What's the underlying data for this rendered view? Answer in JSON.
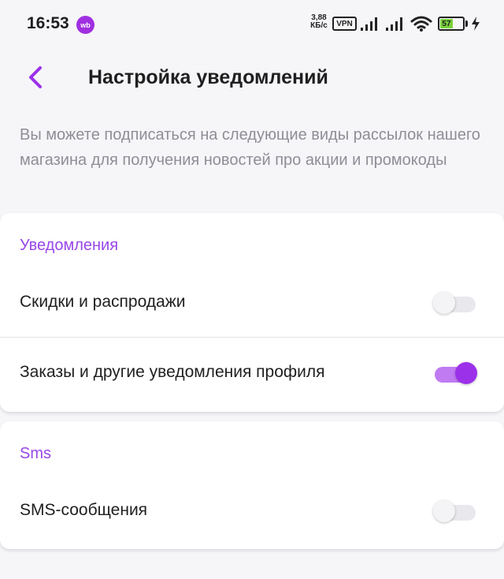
{
  "status_bar": {
    "time": "16:53",
    "app_badge": "wb",
    "net_speed_value": "3,88",
    "net_speed_unit": "КБ/с",
    "vpn": "VPN",
    "battery": "57"
  },
  "header": {
    "title": "Настройка уведомлений",
    "back_icon": "chevron-left-icon"
  },
  "description": "Вы можете подписаться на следующие виды рассылок нашего магазина для получения новостей про акции и промокоды",
  "sections": [
    {
      "title": "Уведомления",
      "items": [
        {
          "label": "Скидки и распродажи",
          "enabled": false
        },
        {
          "label": "Заказы и другие уведомления профиля",
          "enabled": true
        }
      ]
    },
    {
      "title": "Sms",
      "items": [
        {
          "label": "SMS-сообщения",
          "enabled": false
        }
      ]
    }
  ],
  "colors": {
    "accent": "#9c31ea",
    "accent_light": "#c07bf2",
    "section_title": "#9846e8",
    "background": "#f6f5f8",
    "muted_text": "#8e8e96"
  }
}
